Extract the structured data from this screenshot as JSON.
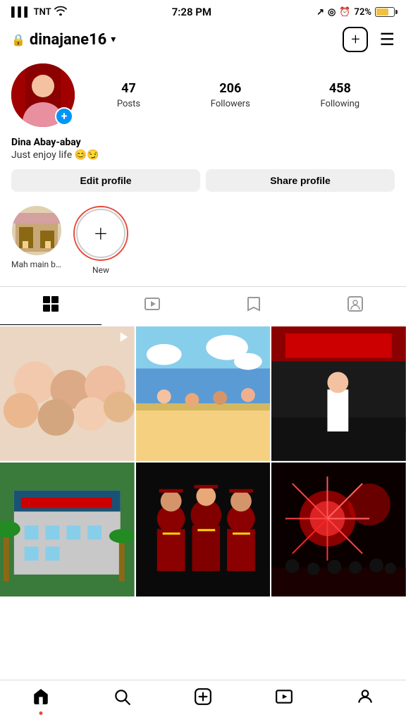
{
  "statusBar": {
    "carrier": "TNT",
    "time": "7:28 PM",
    "battery": "72%",
    "icons": {
      "signal": "signal-icon",
      "wifi": "wifi-icon",
      "location": "location-icon",
      "alarm": "alarm-icon"
    }
  },
  "header": {
    "username": "dinajane16",
    "lockLabel": "🔒",
    "chevron": "▾",
    "addLabel": "+",
    "menuLabel": "☰"
  },
  "profile": {
    "displayName": "Dina Abay-abay",
    "bio": "Just enjoy life 😊😏",
    "stats": {
      "posts": {
        "count": "47",
        "label": "Posts"
      },
      "followers": {
        "count": "206",
        "label": "Followers"
      },
      "following": {
        "count": "458",
        "label": "Following"
      }
    }
  },
  "actionButtons": {
    "editProfile": "Edit profile",
    "shareProfile": "Share profile"
  },
  "stories": [
    {
      "label": "Mah main b...",
      "isNew": false
    },
    {
      "label": "New",
      "isNew": true
    }
  ],
  "contentTabs": [
    {
      "id": "grid",
      "icon": "⊞",
      "active": true
    },
    {
      "id": "reels",
      "icon": "▶",
      "active": false
    },
    {
      "id": "saved",
      "icon": "🔖",
      "active": false
    },
    {
      "id": "tagged",
      "icon": "👤",
      "active": false
    }
  ],
  "photos": [
    {
      "id": 1,
      "isReel": true,
      "colorClass": "photo-1"
    },
    {
      "id": 2,
      "isReel": false,
      "colorClass": "photo-2"
    },
    {
      "id": 3,
      "isReel": false,
      "colorClass": "photo-3"
    },
    {
      "id": 4,
      "isReel": false,
      "colorClass": "photo-4"
    },
    {
      "id": 5,
      "isReel": false,
      "colorClass": "photo-5"
    },
    {
      "id": 6,
      "isReel": false,
      "colorClass": "photo-6"
    }
  ],
  "bottomNav": [
    {
      "id": "home",
      "icon": "🏠",
      "hasDot": true
    },
    {
      "id": "search",
      "icon": "🔍",
      "hasDot": false
    },
    {
      "id": "add",
      "icon": "⊕",
      "hasDot": false
    },
    {
      "id": "reels",
      "icon": "▶",
      "hasDot": false
    },
    {
      "id": "profile",
      "icon": "👤",
      "hasDot": false
    }
  ]
}
